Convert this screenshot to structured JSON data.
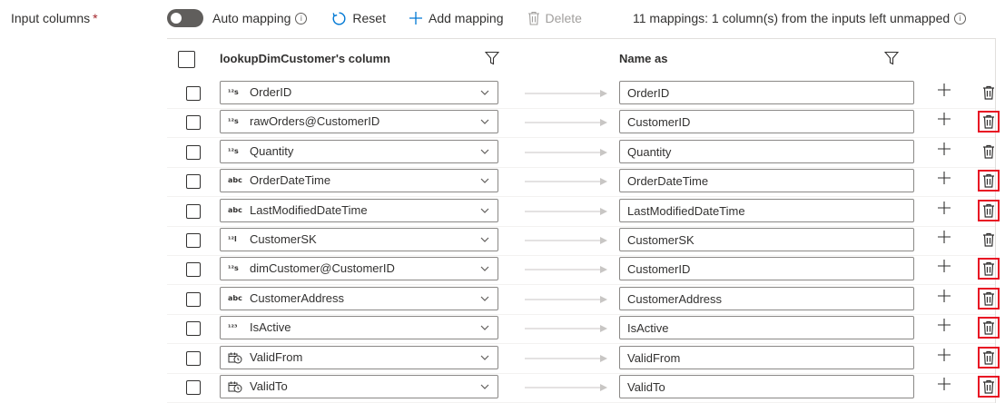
{
  "field": {
    "label": "Input columns",
    "required_mark": "*"
  },
  "toolbar": {
    "auto_mapping_label": "Auto mapping",
    "auto_mapping_on": false,
    "info_glyph": "i",
    "reset_label": "Reset",
    "add_mapping_label": "Add mapping",
    "delete_label": "Delete",
    "summary": "11 mappings: 1 column(s) from the inputs left unmapped"
  },
  "header": {
    "source_title": "lookupDimCustomer's column",
    "target_title": "Name as"
  },
  "rows": [
    {
      "type": "12s",
      "source": "OrderID",
      "target": "OrderID",
      "highlighted": false
    },
    {
      "type": "12s",
      "source": "rawOrders@CustomerID",
      "target": "CustomerID",
      "highlighted": true
    },
    {
      "type": "12s",
      "source": "Quantity",
      "target": "Quantity",
      "highlighted": false
    },
    {
      "type": "abc",
      "source": "OrderDateTime",
      "target": "OrderDateTime",
      "highlighted": true
    },
    {
      "type": "abc",
      "source": "LastModifiedDateTime",
      "target": "LastModifiedDateTime",
      "highlighted": true
    },
    {
      "type": "12l",
      "source": "CustomerSK",
      "target": "CustomerSK",
      "highlighted": false
    },
    {
      "type": "12s",
      "source": "dimCustomer@CustomerID",
      "target": "CustomerID",
      "highlighted": true
    },
    {
      "type": "abc",
      "source": "CustomerAddress",
      "target": "CustomerAddress",
      "highlighted": true
    },
    {
      "type": "123",
      "source": "IsActive",
      "target": "IsActive",
      "highlighted": true
    },
    {
      "type": "datetime-icon",
      "source": "ValidFrom",
      "target": "ValidFrom",
      "highlighted": true
    },
    {
      "type": "datetime-icon",
      "source": "ValidTo",
      "target": "ValidTo",
      "highlighted": true
    }
  ],
  "colors": {
    "accent": "#0078d4",
    "highlight": "#e81123",
    "text": "#323130",
    "trash": "#323130"
  }
}
